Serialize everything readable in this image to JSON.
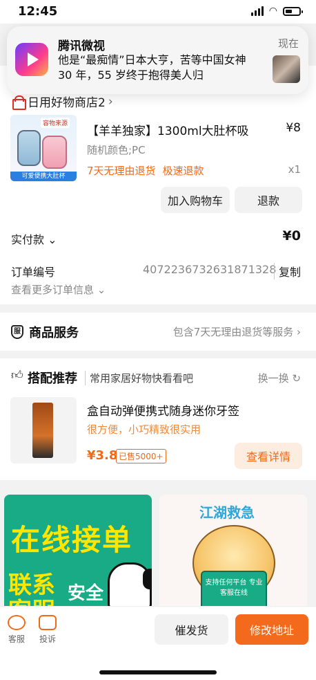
{
  "status_bar": {
    "time": "12:45"
  },
  "notification": {
    "app_name": "腾讯微视",
    "time": "现在",
    "body": "他是“最痴情”日本大亨，苦等中国女神 30 年，55 岁终于抱得美人归"
  },
  "store": {
    "name": "日用好物商店2",
    "chevron": "›"
  },
  "product": {
    "thumb_tag": "容物来源",
    "thumb_banner": "可爱便携大肚杯",
    "title": "【羊羊独家】1300ml大肚杯吸",
    "price": "¥8",
    "spec": "随机颜色;PC",
    "tags": [
      "7天无理由退货",
      "极速退款"
    ],
    "qty": "x1",
    "add_to_cart_label": "加入购物车",
    "refund_label": "退款"
  },
  "payment": {
    "paid_label": "实付款 ⌄",
    "paid_value": "¥0",
    "order_label": "订单编号",
    "order_number": "4072236732631871328",
    "copy_label": "复制",
    "more_label": "查看更多订单信息 ⌄"
  },
  "service": {
    "icon_text": "服",
    "title": "商品服务",
    "desc": "包含7天无理由退货等服务 ›"
  },
  "recommend": {
    "title": "搭配推荐",
    "subtitle": "常用家居好物快看看吧",
    "refresh_label": "换一换 ↻",
    "item_name": "盒自动弹便携式随身迷你牙签",
    "item_desc": "很方便，小巧精致很实用",
    "item_price": "¥3.8",
    "item_sold": "已售5000+",
    "detail_button": "查看详情"
  },
  "banners": {
    "left_text": "在线接单",
    "left_text2": "联系\n客服",
    "left_text3": "安全",
    "right_title": "江湖救急",
    "right_sign": "支持任何平台 专业客服在线"
  },
  "bottom_bar": {
    "kefu_label": "客服",
    "tousu_label": "投诉",
    "ship_label": "催发货",
    "address_label": "修改地址"
  },
  "colors": {
    "accent": "#f46a1c",
    "brand_red": "#e02e24",
    "banner_green": "#19aa86"
  }
}
